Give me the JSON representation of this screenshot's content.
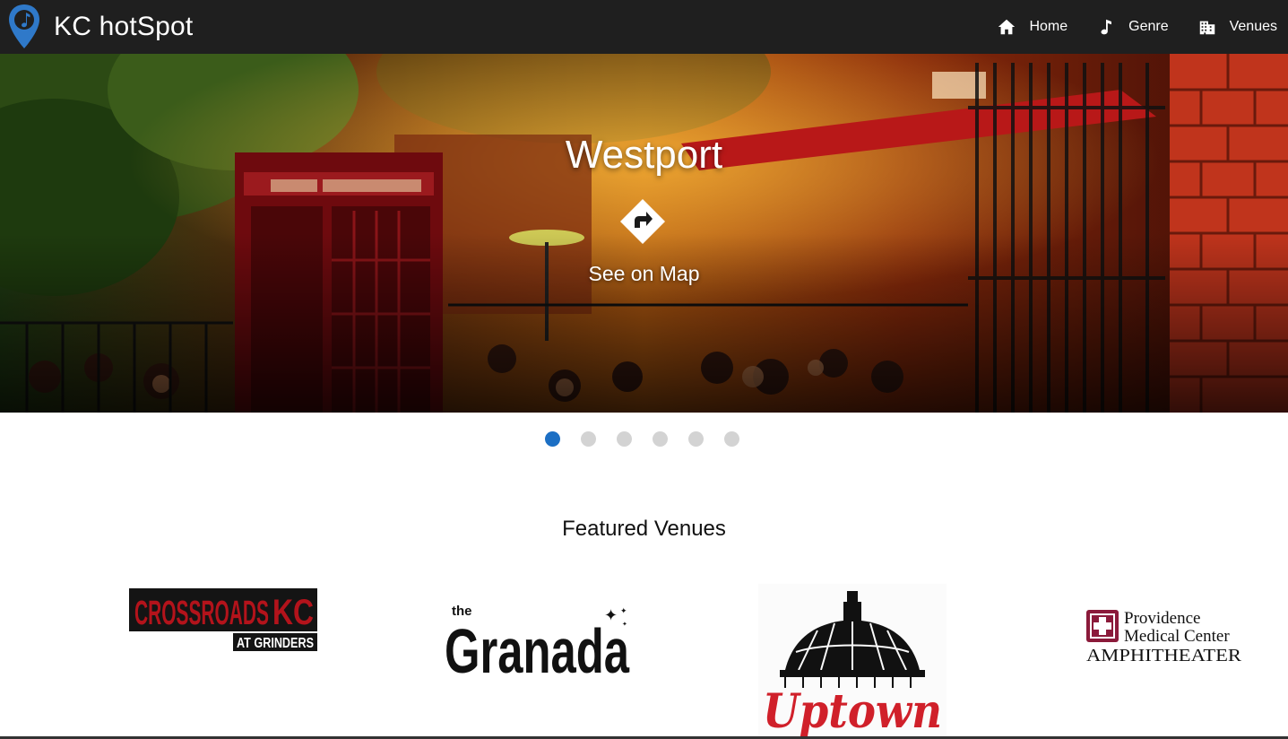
{
  "app": {
    "title": "KC hotSpot"
  },
  "nav": {
    "items": [
      {
        "label": "Home",
        "icon": "home-icon"
      },
      {
        "label": "Genre",
        "icon": "music-note-icon"
      },
      {
        "label": "Venues",
        "icon": "building-icon"
      }
    ]
  },
  "hero": {
    "title": "Westport",
    "map_label": "See on Map",
    "icon": "directions-icon",
    "slide_count": 6,
    "active_slide": 1
  },
  "featured": {
    "title": "Featured Venues",
    "venues": [
      {
        "name": "Crossroads KC at Grinders",
        "logo_text": "CROSSROADS KC",
        "logo_sub": "AT GRINDERS"
      },
      {
        "name": "The Granada",
        "logo_text": "Granada",
        "logo_sub": "the"
      },
      {
        "name": "Uptown",
        "logo_text": "Uptown"
      },
      {
        "name": "Providence Medical Center Amphitheater",
        "logo_lines": [
          "Providence",
          "Medical Center",
          "AMPHITHEATER"
        ]
      }
    ]
  },
  "colors": {
    "navbar": "#1f1f1f",
    "accent": "#1c6fc4",
    "dot_inactive": "#d3d3d3",
    "crossroads_red": "#b3131b",
    "uptown_red": "#d0202a",
    "providence_maroon": "#8b1a3a"
  }
}
